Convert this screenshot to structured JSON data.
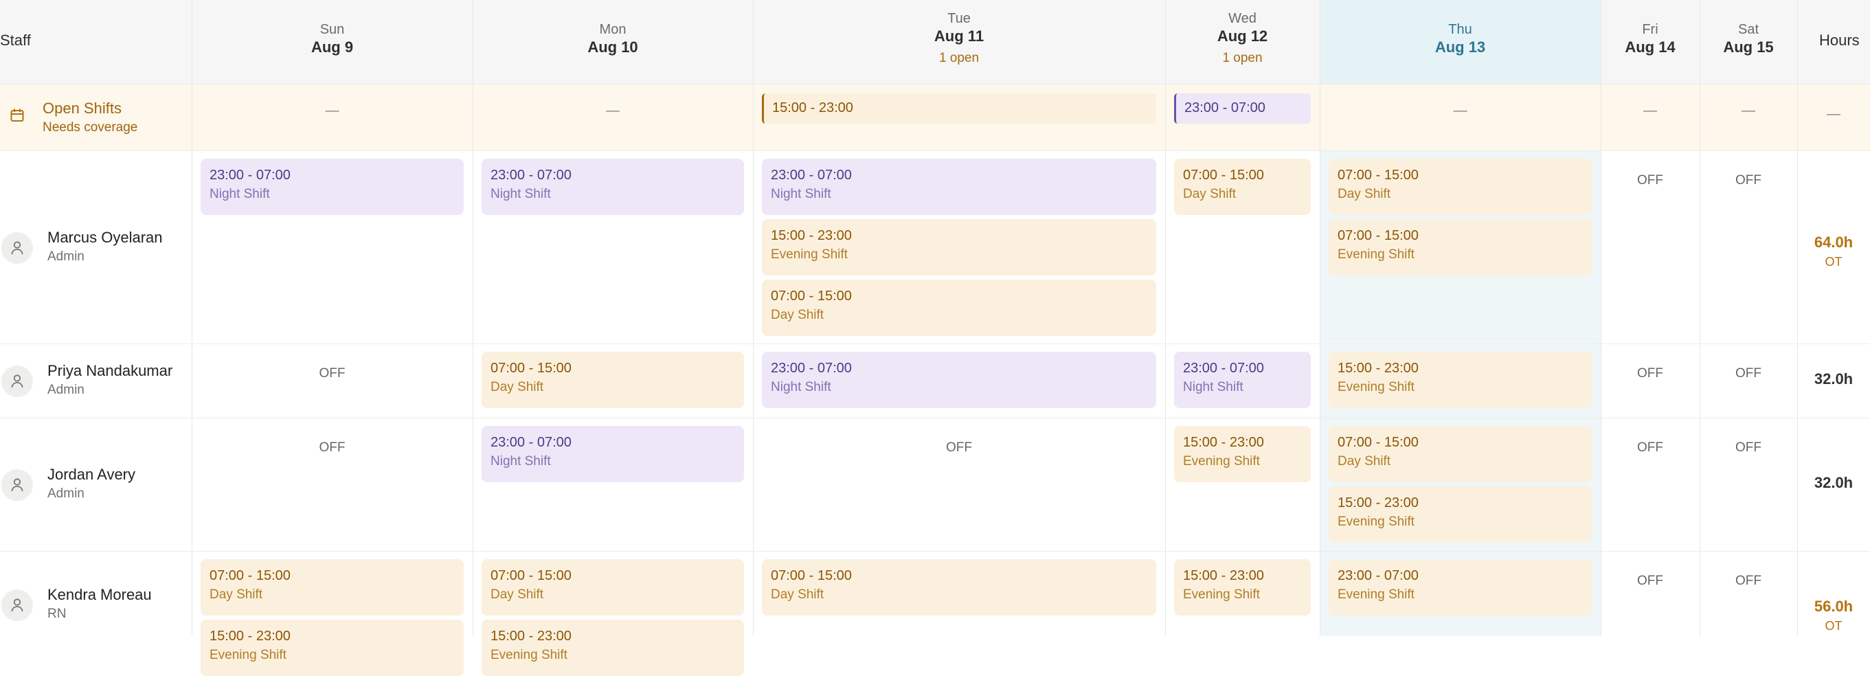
{
  "header": {
    "staff_label": "Staff",
    "hours_label": "Hours",
    "days": [
      {
        "name": "Sun",
        "date": "Aug 9",
        "open": ""
      },
      {
        "name": "Mon",
        "date": "Aug 10",
        "open": ""
      },
      {
        "name": "Tue",
        "date": "Aug 11",
        "open": "1 open"
      },
      {
        "name": "Wed",
        "date": "Aug 12",
        "open": "1 open"
      },
      {
        "name": "Thu",
        "date": "Aug 13",
        "open": "",
        "today": true
      },
      {
        "name": "Fri",
        "date": "Aug 14",
        "open": ""
      },
      {
        "name": "Sat",
        "date": "Aug 15",
        "open": ""
      }
    ]
  },
  "open_shifts": {
    "title": "Open Shifts",
    "subtitle": "Needs coverage",
    "icon": "calendar-icon",
    "empty_mark": "—",
    "hours_mark": "—",
    "days": [
      [],
      [],
      [
        {
          "time": "15:00 - 23:00",
          "kind": "warm"
        }
      ],
      [
        {
          "time": "23:00 - 07:00",
          "kind": "night"
        }
      ],
      [],
      [],
      []
    ]
  },
  "off_label": "OFF",
  "staff": [
    {
      "name": "Marcus Oyelaran",
      "role": "Admin",
      "hours": "64.0h",
      "ot": "OT",
      "days": [
        [
          {
            "time": "23:00 - 07:00",
            "name": "Night Shift",
            "kind": "night"
          }
        ],
        [
          {
            "time": "23:00 - 07:00",
            "name": "Night Shift",
            "kind": "night"
          }
        ],
        [
          {
            "time": "23:00 - 07:00",
            "name": "Night Shift",
            "kind": "night"
          },
          {
            "time": "15:00 - 23:00",
            "name": "Evening Shift",
            "kind": "warm"
          },
          {
            "time": "07:00 - 15:00",
            "name": "Day Shift",
            "kind": "warm"
          }
        ],
        [
          {
            "time": "07:00 - 15:00",
            "name": "Day Shift",
            "kind": "warm"
          }
        ],
        [
          {
            "time": "07:00 - 15:00",
            "name": "Day Shift",
            "kind": "warm"
          },
          {
            "time": "07:00 - 15:00",
            "name": "Evening Shift",
            "kind": "warm"
          }
        ],
        "OFF",
        "OFF"
      ]
    },
    {
      "name": "Priya Nandakumar",
      "role": "Admin",
      "hours": "32.0h",
      "ot": "",
      "days": [
        "OFF",
        [
          {
            "time": "07:00 - 15:00",
            "name": "Day Shift",
            "kind": "warm"
          }
        ],
        [
          {
            "time": "23:00 - 07:00",
            "name": "Night Shift",
            "kind": "night"
          }
        ],
        [
          {
            "time": "23:00 - 07:00",
            "name": "Night Shift",
            "kind": "night"
          }
        ],
        [
          {
            "time": "15:00 - 23:00",
            "name": "Evening Shift",
            "kind": "warm"
          }
        ],
        "OFF",
        "OFF"
      ]
    },
    {
      "name": "Jordan Avery",
      "role": "Admin",
      "hours": "32.0h",
      "ot": "",
      "days": [
        "OFF",
        [
          {
            "time": "23:00 - 07:00",
            "name": "Night Shift",
            "kind": "night"
          }
        ],
        "OFF",
        [
          {
            "time": "15:00 - 23:00",
            "name": "Evening Shift",
            "kind": "warm"
          }
        ],
        [
          {
            "time": "07:00 - 15:00",
            "name": "Day Shift",
            "kind": "warm"
          },
          {
            "time": "15:00 - 23:00",
            "name": "Evening Shift",
            "kind": "warm"
          }
        ],
        "OFF",
        "OFF"
      ]
    },
    {
      "name": "Kendra Moreau",
      "role": "RN",
      "hours": "56.0h",
      "ot": "OT",
      "days": [
        [
          {
            "time": "07:00 - 15:00",
            "name": "Day Shift",
            "kind": "warm"
          },
          {
            "time": "15:00 - 23:00",
            "name": "Evening Shift",
            "kind": "warm"
          }
        ],
        [
          {
            "time": "07:00 - 15:00",
            "name": "Day Shift",
            "kind": "warm"
          },
          {
            "time": "15:00 - 23:00",
            "name": "Evening Shift",
            "kind": "warm"
          }
        ],
        [
          {
            "time": "07:00 - 15:00",
            "name": "Day Shift",
            "kind": "warm"
          }
        ],
        [
          {
            "time": "15:00 - 23:00",
            "name": "Evening Shift",
            "kind": "warm"
          }
        ],
        [
          {
            "time": "23:00 - 07:00",
            "name": "Evening Shift",
            "kind": "warm"
          }
        ],
        "OFF",
        "OFF"
      ]
    }
  ],
  "colors": {
    "header_bg": "#f5f6f5",
    "open_row_bg": "#fdf7ec",
    "today_bg": "#e6f3f6",
    "today_col_bg": "#eef6f8",
    "night_card": "#ede7f7",
    "warm_card": "#fbf0dd",
    "ot_accent": "#b5720e"
  }
}
